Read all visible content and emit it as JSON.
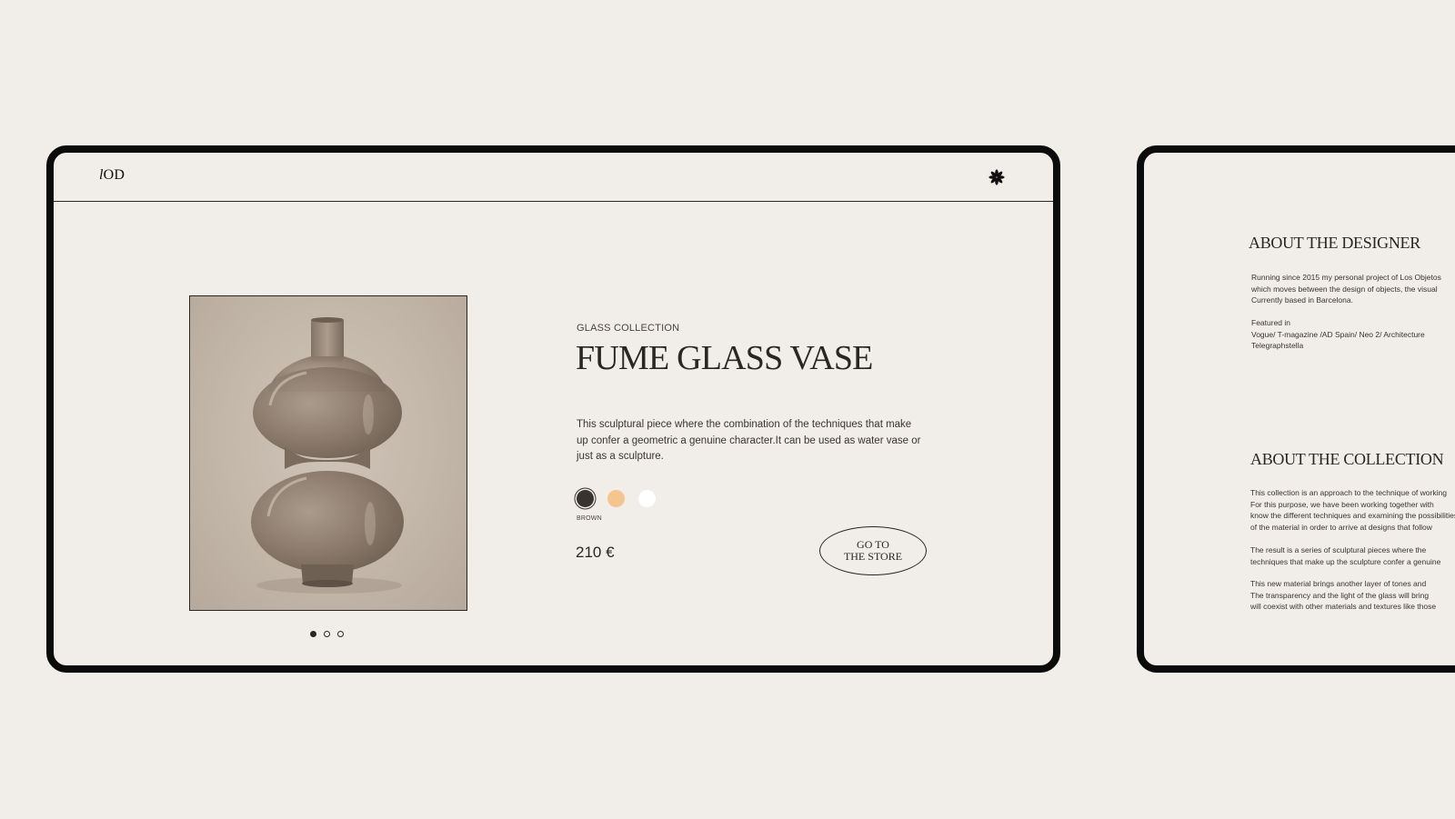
{
  "colors": {
    "background": "#f1ede9",
    "frame": "#0b0b0b",
    "text": "#2a2624",
    "swatch_brown": "#38332f",
    "swatch_peach": "#f5c58e",
    "swatch_white": "#ffffff"
  },
  "header": {
    "logo_prefix": "l",
    "logo_suffix": "OD",
    "menu_icon": "asterisk-flower-icon"
  },
  "product": {
    "image_alt": "smoked glass double-bulb vase",
    "carousel": {
      "count": 3,
      "active_index": 0
    },
    "collection": "GLASS COLLECTION",
    "title": "FUME GLASS VASE",
    "description": "This sculptural piece where the combination of the techniques that make up confer a geometric a genuine character.It can be used as water vase or just as a sculpture.",
    "colors": [
      {
        "name": "BROWN",
        "hex": "#38332f",
        "selected": true
      },
      {
        "name": "",
        "hex": "#f5c58e",
        "selected": false
      },
      {
        "name": "",
        "hex": "#ffffff",
        "selected": false
      }
    ],
    "selected_color_label": "BROWN",
    "price": "210 €",
    "cta_line1": "GO TO",
    "cta_line2": "THE STORE"
  },
  "side": {
    "designer_heading": "ABOUT THE DESIGNER",
    "designer_lines": [
      "Running since 2015 my personal project of Los Objetos",
      "which moves between the design of objects, the visual",
      "Currently based in Barcelona."
    ],
    "featured_label": "Featured in",
    "featured_lines": [
      "Vogue/ T-magazine /AD Spain/ Neo 2/ Architecture",
      "Telegraphstella"
    ],
    "collection_heading": "ABOUT THE COLLECTION",
    "collection_p1": [
      "This collection is an approach to the technique of working",
      "For this purpose, we have been working together with",
      "know the different techniques and examining the possibilities",
      "of the material in order to arrive at designs that follow"
    ],
    "collection_p2": [
      "The result is a series of sculptural pieces where the",
      "techniques that make up the sculpture confer a genuine"
    ],
    "collection_p3": [
      "This new material brings another layer of tones and",
      "The transparency and the light of the glass will bring",
      "will coexist with other materials and textures like those"
    ]
  }
}
